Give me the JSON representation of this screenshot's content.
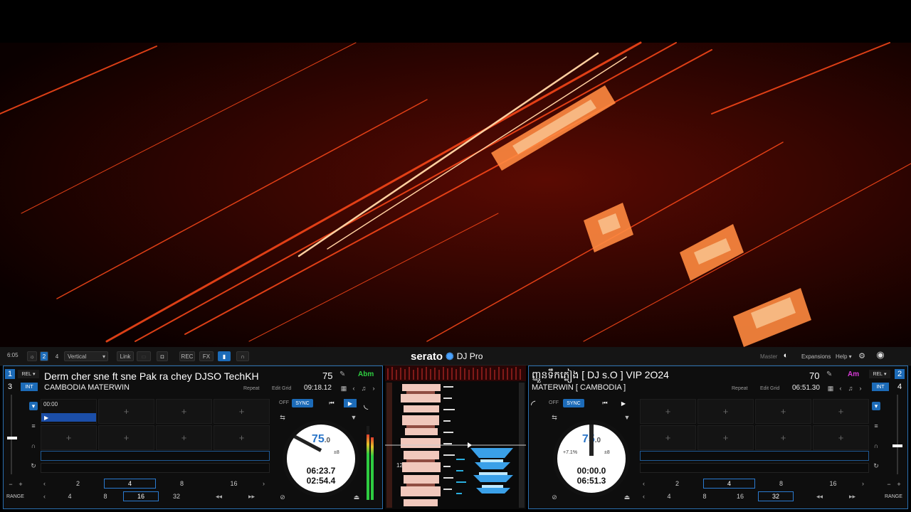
{
  "topbar": {
    "clock": "6:05",
    "deck_count_2": "2",
    "deck_count_4": "4",
    "layout": "Vertical",
    "link": "Link",
    "rec": "REC",
    "fx": "FX",
    "logo_text": "serato",
    "logo_sub": "DJ Pro",
    "master": "Master",
    "expansions": "Expansions",
    "help": "Help"
  },
  "deck_left": {
    "num_top": "1",
    "num_bottom": "3",
    "mode": "REL",
    "int": "INT",
    "title": "Derm cher sne ft sne Pak ra chey  DJSO TechKH",
    "artist": "CAMBODIA MATERWIN",
    "bpm": "75",
    "key": "Abm",
    "repeat": "Repeat",
    "edit_grid": "Edit Grid",
    "length": "09:18.12",
    "off": "OFF",
    "sync": "SYNC",
    "cue_time": "00:00",
    "platter_bpm": "75",
    "platter_bpm_dec": ".0",
    "platter_range": "±8",
    "elapsed": "06:23.7",
    "remaining": "02:54.4",
    "loop_top": [
      "2",
      "4",
      "8",
      "16"
    ],
    "loop_bottom": [
      "4",
      "8",
      "16",
      "32"
    ],
    "range": "RANGE"
  },
  "deck_right": {
    "num_top": "2",
    "num_bottom": "4",
    "mode": "REL",
    "int": "INT",
    "title": "ញ្ញួនទឹកភ្លៀង [ DJ s.O ] VIP 2O24",
    "artist": "MATERWIN  [ CAMBODIA ]",
    "bpm": "70",
    "key": "Am",
    "repeat": "Repeat",
    "edit_grid": "Edit Grid",
    "length": "06:51.30",
    "off": "OFF",
    "sync": "SYNC",
    "platter_bpm": "75",
    "platter_bpm_dec": ".0",
    "platter_pitch": "+7.1%",
    "platter_range": "±8",
    "elapsed": "00:00.0",
    "remaining": "06:51.3",
    "loop_top": [
      "2",
      "4",
      "8",
      "16"
    ],
    "loop_bottom": [
      "4",
      "8",
      "16",
      "32"
    ],
    "range": "RANGE"
  },
  "center": {
    "marker": "12"
  },
  "colors": {
    "accent": "#1c6bb8",
    "key_left": "#2ecc40",
    "key_right": "#d63ad6"
  }
}
